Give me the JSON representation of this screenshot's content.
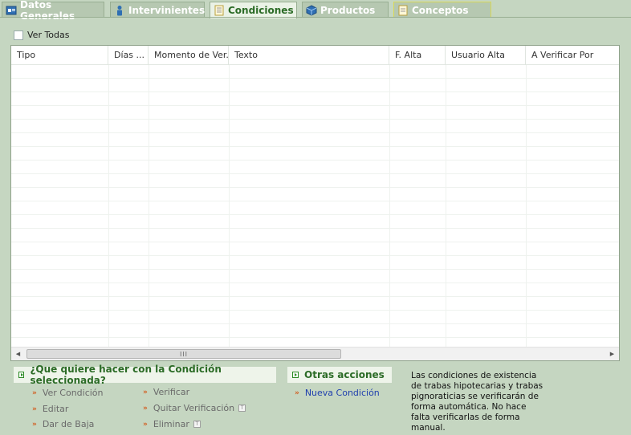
{
  "tabs": [
    {
      "label": "Datos Generales",
      "icon": "id-card-icon",
      "active": false
    },
    {
      "label": "Intervinientes",
      "icon": "person-icon",
      "active": false
    },
    {
      "label": "Condiciones",
      "icon": "document-icon",
      "active": true
    },
    {
      "label": "Productos",
      "icon": "cube-icon",
      "active": false
    },
    {
      "label": "Conceptos",
      "icon": "notepad-icon",
      "active": false
    }
  ],
  "ver_todas": {
    "label": "Ver Todas",
    "checked": false
  },
  "grid": {
    "columns": [
      "Tipo",
      "Días ...",
      "Momento de Ver...",
      "Texto",
      "F. Alta",
      "Usuario Alta",
      "A Verificar Por"
    ],
    "rows": [],
    "scroll_thumb_glyph": "III"
  },
  "panel_selected": {
    "title": "¿Que quiere hacer con la Condición seleccionada?",
    "actions_col1": [
      "Ver Condición",
      "Editar",
      "Dar de Baja"
    ],
    "actions_col2": [
      "Verificar",
      "Quitar Verificación",
      "Eliminar"
    ]
  },
  "panel_other": {
    "title": "Otras acciones",
    "actions": [
      "Nueva Condición"
    ]
  },
  "info_text": "Las condiciones de existencia de trabas hipotecarias y trabas pignoraticias se verificarán de forma automática. No hace falta verificarlas de forma manual.",
  "colors": {
    "background": "#c5d6c1",
    "active_tab_text": "#2b6b26",
    "link": "#1f3fae",
    "bullet": "#d35a1b"
  }
}
